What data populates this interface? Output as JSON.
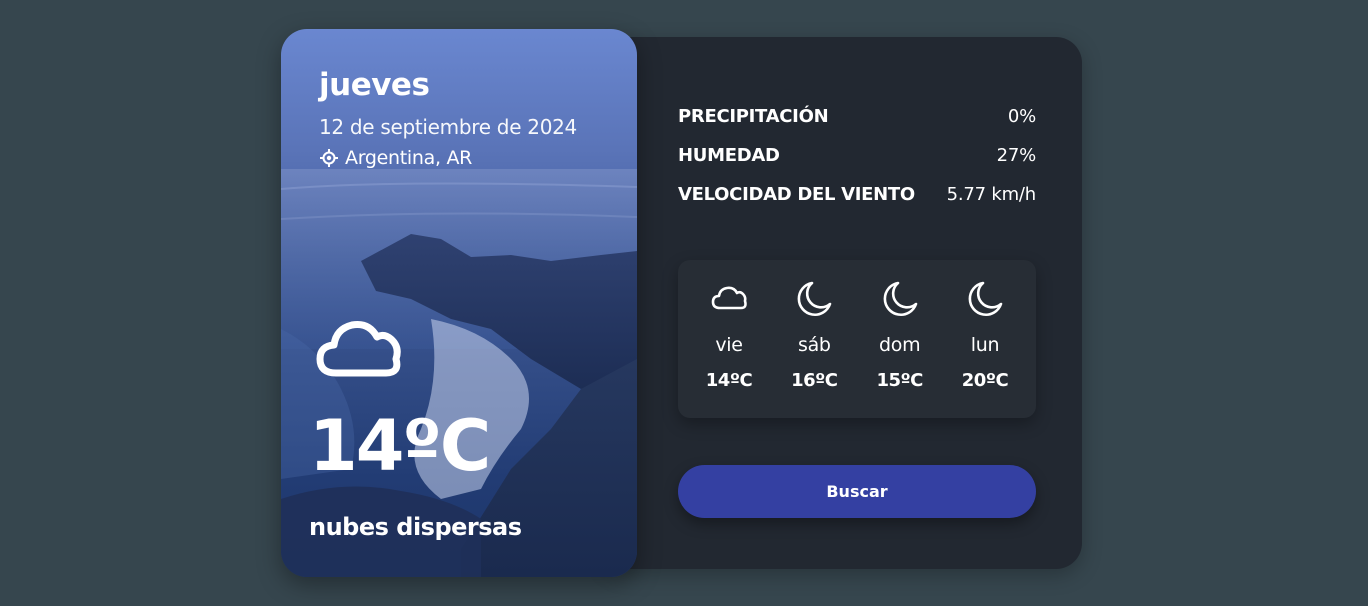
{
  "hero": {
    "day": "jueves",
    "date": "12 de septiembre de 2024",
    "location": "Argentina, AR",
    "location_icon": "location-crosshair-icon",
    "weather_icon": "cloud-icon",
    "temperature": "14ºC",
    "description": "nubes dispersas"
  },
  "stats": [
    {
      "label": "PRECIPITACIÓN",
      "value": "0%"
    },
    {
      "label": "HUMEDAD",
      "value": "27%"
    },
    {
      "label": "VELOCIDAD DEL VIENTO",
      "value": "5.77 km/h"
    }
  ],
  "forecast": [
    {
      "icon": "cloud-icon",
      "day": "vie",
      "temp": "14ºC"
    },
    {
      "icon": "moon-icon",
      "day": "sáb",
      "temp": "16ºC"
    },
    {
      "icon": "moon-icon",
      "day": "dom",
      "temp": "15ºC"
    },
    {
      "icon": "moon-icon",
      "day": "lun",
      "temp": "20ºC"
    }
  ],
  "search_button": {
    "label": "Buscar"
  },
  "colors": {
    "page_background": "#36464e",
    "card_background": "#222831",
    "forecast_background": "#272d35",
    "button_background": "#3440a2"
  }
}
